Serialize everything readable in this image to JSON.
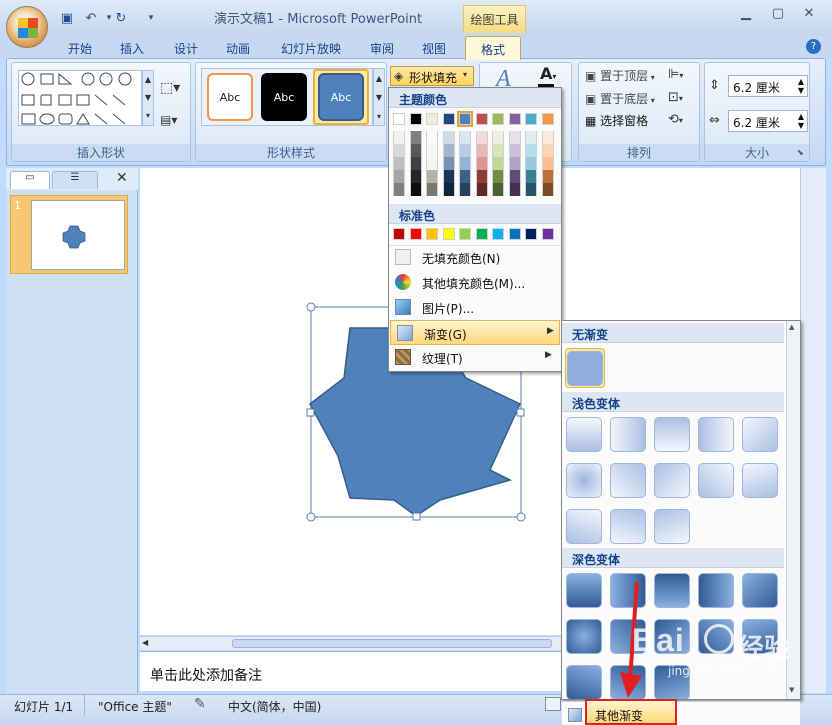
{
  "window": {
    "doc_title": "演示文稿1 - Microsoft PowerPoint",
    "contextual_tab": "绘图工具",
    "qat": [
      "save-icon",
      "undo-icon",
      "redo-icon",
      "customize-icon"
    ],
    "controls": [
      "minimize-icon",
      "maximize-icon",
      "close-icon"
    ]
  },
  "tabs": [
    "开始",
    "插入",
    "设计",
    "动画",
    "幻灯片放映",
    "审阅",
    "视图",
    "格式"
  ],
  "ribbon": {
    "insert_shapes_label": "插入形状",
    "shape_styles_label": "形状样式",
    "shape_fill_label": "形状填充",
    "arrange_label": "排列",
    "size_label": "大小",
    "style_sample": "Abc",
    "bring_front": "置于顶层",
    "send_back": "置于底层",
    "selection_pane": "选择窗格",
    "height_value": "6.2 厘米",
    "width_value": "6.2 厘米"
  },
  "slide_panel": {
    "slide_number": "1"
  },
  "notes_placeholder": "单击此处添加备注",
  "status": {
    "slide": "幻灯片 1/1",
    "theme": "\"Office 主题\"",
    "language": "中文(简体，中国)"
  },
  "fill_menu": {
    "theme_colors_header": "主题颜色",
    "standard_colors_header": "标准色",
    "no_fill": "无填充颜色(N)",
    "more_colors": "其他填充颜色(M)...",
    "picture": "图片(P)...",
    "gradient": "渐变(G)",
    "texture": "纹理(T)",
    "theme_colors": [
      "#ffffff",
      "#000000",
      "#eeece1",
      "#1f497d",
      "#4f81bd",
      "#c0504d",
      "#9bbb59",
      "#8064a2",
      "#4bacc6",
      "#f79646"
    ],
    "standard_colors": [
      "#c00000",
      "#ff0000",
      "#ffc000",
      "#ffff00",
      "#92d050",
      "#00b050",
      "#00b0f0",
      "#0070c0",
      "#002060",
      "#7030a0"
    ]
  },
  "gradient_menu": {
    "no_gradient_header": "无渐变",
    "light_header": "浅色变体",
    "dark_header": "深色变体",
    "more_gradients": "其他渐变(M)..."
  },
  "watermark": {
    "brand": "Bai",
    "site": "jingyan.baidu.com",
    "text": "经验"
  },
  "colors": {
    "shape_fill": "#4f81bd",
    "shape_border": "#385d8a",
    "highlight": "#ffd56b",
    "arrow": "#e02020"
  }
}
